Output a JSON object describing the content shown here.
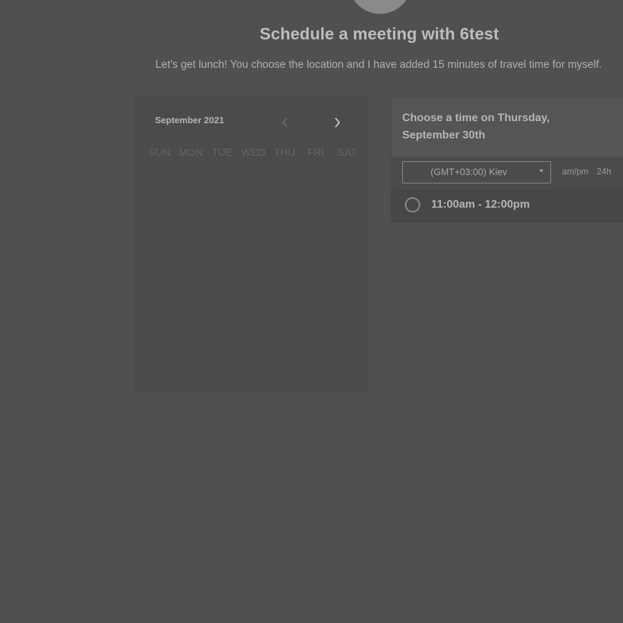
{
  "header": {
    "title": "Schedule a meeting with 6test",
    "description": "Let's get lunch! You choose the location and I have added 15 minutes of travel time for myself."
  },
  "calendar": {
    "month_label": "September 2021",
    "prev_icon": "chevron-left-icon",
    "next_icon": "chevron-right-icon",
    "weekdays": [
      "SUN",
      "MON",
      "TUE",
      "WED",
      "THU",
      "FRI",
      "SAT"
    ]
  },
  "times": {
    "heading": "Choose a time on Thursday, September 30th",
    "timezone": {
      "selected": "(GMT+03:00) Kiev",
      "icon": "caret-down-icon"
    },
    "format_ampm": "am/pm",
    "format_24h": "24h",
    "slots": [
      {
        "label": "11:00am - 12:00pm",
        "selected": false
      }
    ]
  },
  "colors": {
    "background": "#505050",
    "panel": "#4b4b4b",
    "panel_header": "#555555",
    "text_primary": "#bdbdbd",
    "text_muted": "#656565"
  }
}
